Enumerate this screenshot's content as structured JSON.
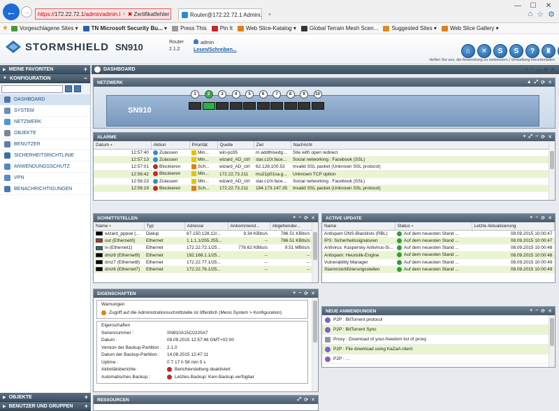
{
  "browser": {
    "url_prefix": "https://",
    "url_host": "172.22.72.1",
    "url_path": "/admin/admin.l",
    "cert_error": "Zertifikatfehler",
    "tab_title": "Router@172.22.72.1 Admini...",
    "tab_close": "×",
    "new_tab": "+",
    "window_controls": [
      "—",
      "☐",
      "✕"
    ],
    "toolbar_icons": [
      "home-icon",
      "star-icon",
      "gear-icon"
    ]
  },
  "favorites_bar": [
    {
      "label": "Vorgeschlagene Sites ▾",
      "color": "#4a9a3a"
    },
    {
      "label": "TN Microsoft Security Bu... ▾",
      "color": "#2b5fae",
      "bold": true
    },
    {
      "label": "Press This",
      "color": "#999999"
    },
    {
      "label": "Pin It",
      "color": "#c8232c"
    },
    {
      "label": "Web Slice-Katalog ▾",
      "color": "#e07f18"
    },
    {
      "label": "Global Terrain Mesh Scen...",
      "color": "#333333"
    },
    {
      "label": "Suggested Sites ▾",
      "color": "#e08a1a"
    },
    {
      "label": "Web Slice Gallery ▾",
      "color": "#e07f18"
    }
  ],
  "header": {
    "brand": "STORMSHIELD",
    "model": "SN910",
    "router_label": "Router",
    "version": "2.1.2",
    "user": "admin",
    "access_link": "Lesen/Schreiben...",
    "help_text": "Helfen Sie uns, die Anwendung zu verbessern | Verwaltung herunterladen",
    "icons": [
      "⌂",
      "✕",
      "S",
      "S",
      "?",
      "♜",
      "◂"
    ]
  },
  "sidebar": {
    "favorites": "MEINE FAVORITEN",
    "configuration": "KONFIGURATION",
    "items": [
      {
        "label": "DASHBOARD",
        "color": "#4a78b0",
        "active": true
      },
      {
        "label": "SYSTEM",
        "color": "#6e8fb3"
      },
      {
        "label": "NETZWERK",
        "color": "#4c9ad4"
      },
      {
        "label": "OBJEKTE",
        "color": "#7a8896"
      },
      {
        "label": "BENUTZER",
        "color": "#5a7fb0"
      },
      {
        "label": "SICHERHEITSRICHTLINIE",
        "color": "#3a6fb0"
      },
      {
        "label": "ANWENDUNGSSCHUTZ",
        "color": "#4c89c8"
      },
      {
        "label": "VPN",
        "color": "#5a8bc0"
      },
      {
        "label": "BENACHRICHTIGUNGEN",
        "color": "#4a78b0"
      }
    ],
    "bottom": [
      "OBJEKTE",
      "BENUTZER UND GRUPPEN"
    ]
  },
  "dashboard": {
    "title": "DASHBOARD"
  },
  "network": {
    "title": "NETZWERK",
    "device": "SN910",
    "ports": [
      "1",
      "2",
      "3",
      "4",
      "5",
      "6",
      "7",
      "8",
      "9",
      "10"
    ],
    "active_port": 1
  },
  "alarms": {
    "title": "ALARME",
    "columns": [
      "Datum",
      "Aktion",
      "Priorität",
      "Quelle",
      "Ziel",
      "Nachricht"
    ],
    "rows": [
      [
        "12:57:40",
        "Zulassen",
        "Min...",
        "win-pc05",
        "m.addthisedg...",
        "Site with open redirect"
      ],
      [
        "12:57:13",
        "Zulassen",
        "Min...",
        "wizard_AD_ctrl",
        "star.c10r.face...",
        "Social networking : Facebook (SSL)"
      ],
      [
        "12:57:01",
        "Blockieren",
        "Sch...",
        "wizard_AD_ctrl",
        "62.128.100.53",
        "Invalid SSL packet (Unknown SSL protocol)"
      ],
      [
        "12:56:42",
        "Blockieren",
        "Min...",
        "172.22.73.211",
        "mu21p01sa.g...",
        "Unknown TCP option"
      ],
      [
        "12:56:23",
        "Zulassen",
        "Min...",
        "wizard_AD_ctrl",
        "star.c10r.face...",
        "Social networking : Facebook (SSL)"
      ],
      [
        "12:56:19",
        "Blockieren",
        "Sch...",
        "172.22.73.211",
        "184.173.147.35",
        "Invalid SSL packet (Unknown SSL protocol)"
      ]
    ]
  },
  "interfaces": {
    "title": "SCHNITTSTELLEN",
    "columns": [
      "Name",
      "Typ",
      "Adresse",
      "Ankommend...",
      "Abgehender..."
    ],
    "rows": [
      [
        "wizard_pppoe (...",
        "Dialup",
        "87.150.128.12/...",
        "9.34 KBits/s",
        "786.51 KBits/s"
      ],
      [
        "out (Ethernet0)",
        "Ethernet",
        "1.1.1.1/255.255...",
        "--",
        "786.51 KBits/s"
      ],
      [
        "in (Ethernet1)",
        "Ethernet",
        "172.22.72.1/25...",
        "776.62 KBits/s",
        "9.51 MBits/s"
      ],
      [
        "dmz8 (Ethernet9)",
        "Ethernet",
        "192.168.1.1/25...",
        "--",
        "--"
      ],
      [
        "dmz7 (Ethernet8)",
        "Ethernet",
        "172.22.77.1/25...",
        "--",
        "--"
      ],
      [
        "dmz6 (Ethernet7)",
        "Ethernet",
        "172.22.76.1/25...",
        "--",
        "--"
      ]
    ],
    "swatches": [
      "#000000",
      "#b03030",
      "#207070",
      "#000000",
      "#000000",
      "#000000"
    ]
  },
  "active_update": {
    "title": "ACTIVE UPDATE",
    "columns": [
      "Name",
      "Status",
      "Letzte Aktualisierung"
    ],
    "rows": [
      [
        "Antispam DNS-Blacklists (RBL)",
        "Auf dem neuesten Stand ...",
        "08.09.2015 10:00:47"
      ],
      [
        "IPS: Sicherheitssignaturen",
        "Auf dem neuesten Stand ...",
        "08.09.2015 10:00:47"
      ],
      [
        "Antivirus: Kaspersky Antivirus-Si...",
        "Auf dem neuesten Stand ...",
        "08.09.2015 10:00:48"
      ],
      [
        "Antispam: Heuristik-Engine",
        "Auf dem neuesten Stand ...",
        "08.09.2015 10:00:48"
      ],
      [
        "Vulnerability Manager",
        "Auf dem neuesten Stand ...",
        "08.09.2015 10:00:49"
      ],
      [
        "Stammzertifizierungsstellen",
        "Auf dem neuesten Stand ...",
        "08.09.2015 10:00:49"
      ]
    ]
  },
  "properties": {
    "title": "EIGENSCHAFTEN",
    "warnings_label": "Warnungen",
    "warning": "Zugriff auf die Administrationsschnittstelle ist öffentlich (Menü System > Konfiguration)",
    "props_label": "Eigenschaften",
    "rows": [
      [
        "Seriennummer :",
        "SN910A15C0220A7"
      ],
      [
        "Datum :",
        "08.09.2015 12:57:46 GMT+02:00"
      ],
      [
        "Version der Backup-Partition :",
        "2.1.0"
      ],
      [
        "Datum der Backup-Partition :",
        "14.08.2015 12:47:11"
      ],
      [
        "Uptime :",
        "0 T 17 h 58 min 5 s"
      ],
      [
        "Aktivitätsberichte :",
        "Berichterstellung deaktiviert"
      ],
      [
        "Automatisches Backup :",
        "Letztes Backup: Kein Backup verfügbar"
      ]
    ]
  },
  "new_apps": {
    "title": "NEUE ANWENDUNGEN",
    "rows": [
      "P2P : BitTorrent protocol",
      "P2P : BitTorrent Sync",
      "Proxy : Download of your-freedom list of proxy",
      "P2P : File download using KaZaA client",
      "P2P : ..."
    ]
  },
  "resources": {
    "title": "RESSOURCEN"
  }
}
